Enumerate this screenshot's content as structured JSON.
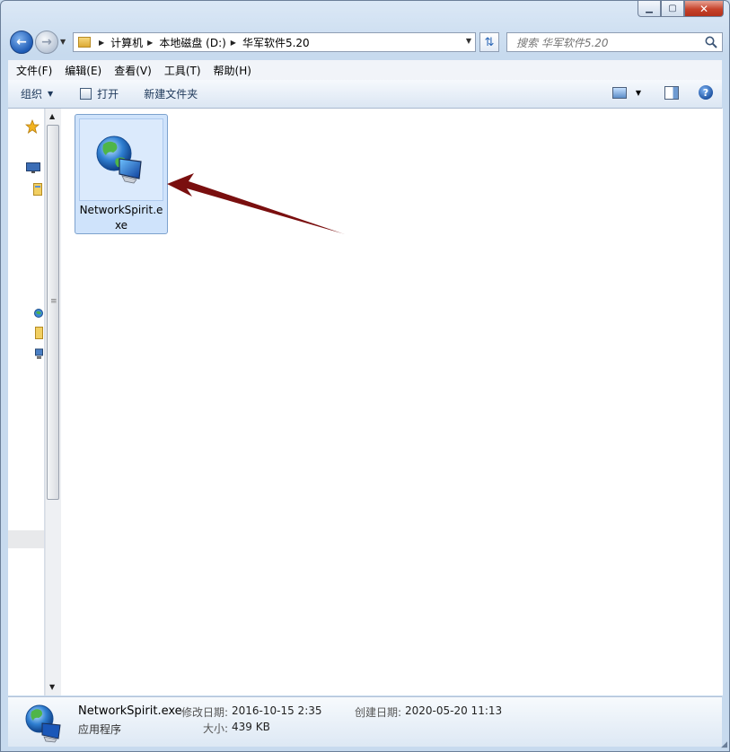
{
  "window": {
    "caption_min": "▁",
    "caption_max": "▢",
    "caption_close": "✕"
  },
  "nav": {
    "back_glyph": "←",
    "forward_glyph": "→",
    "breadcrumbs": [
      "计算机",
      "本地磁盘 (D:)",
      "华军软件5.20"
    ],
    "search_placeholder": "搜索 华军软件5.20"
  },
  "menu": {
    "items": [
      "文件(F)",
      "编辑(E)",
      "查看(V)",
      "工具(T)",
      "帮助(H)"
    ]
  },
  "commands": {
    "organize": "组织",
    "open": "打开",
    "new_folder": "新建文件夹",
    "help_glyph": "?"
  },
  "files": [
    {
      "name": "NetworkSpirit.exe",
      "icon": "network-globe-icon",
      "selected": true
    }
  ],
  "details": {
    "name": "NetworkSpirit.exe",
    "type": "应用程序",
    "modified_label": "修改日期:",
    "modified_value": "2016-10-15 2:35",
    "created_label": "创建日期:",
    "created_value": "2020-05-20 11:13",
    "size_label": "大小:",
    "size_value": "439 KB"
  },
  "colors": {
    "annotation_arrow": "#7a0f0f",
    "selection_fill": "#cfe3fb",
    "selection_border": "#7da2ce"
  }
}
